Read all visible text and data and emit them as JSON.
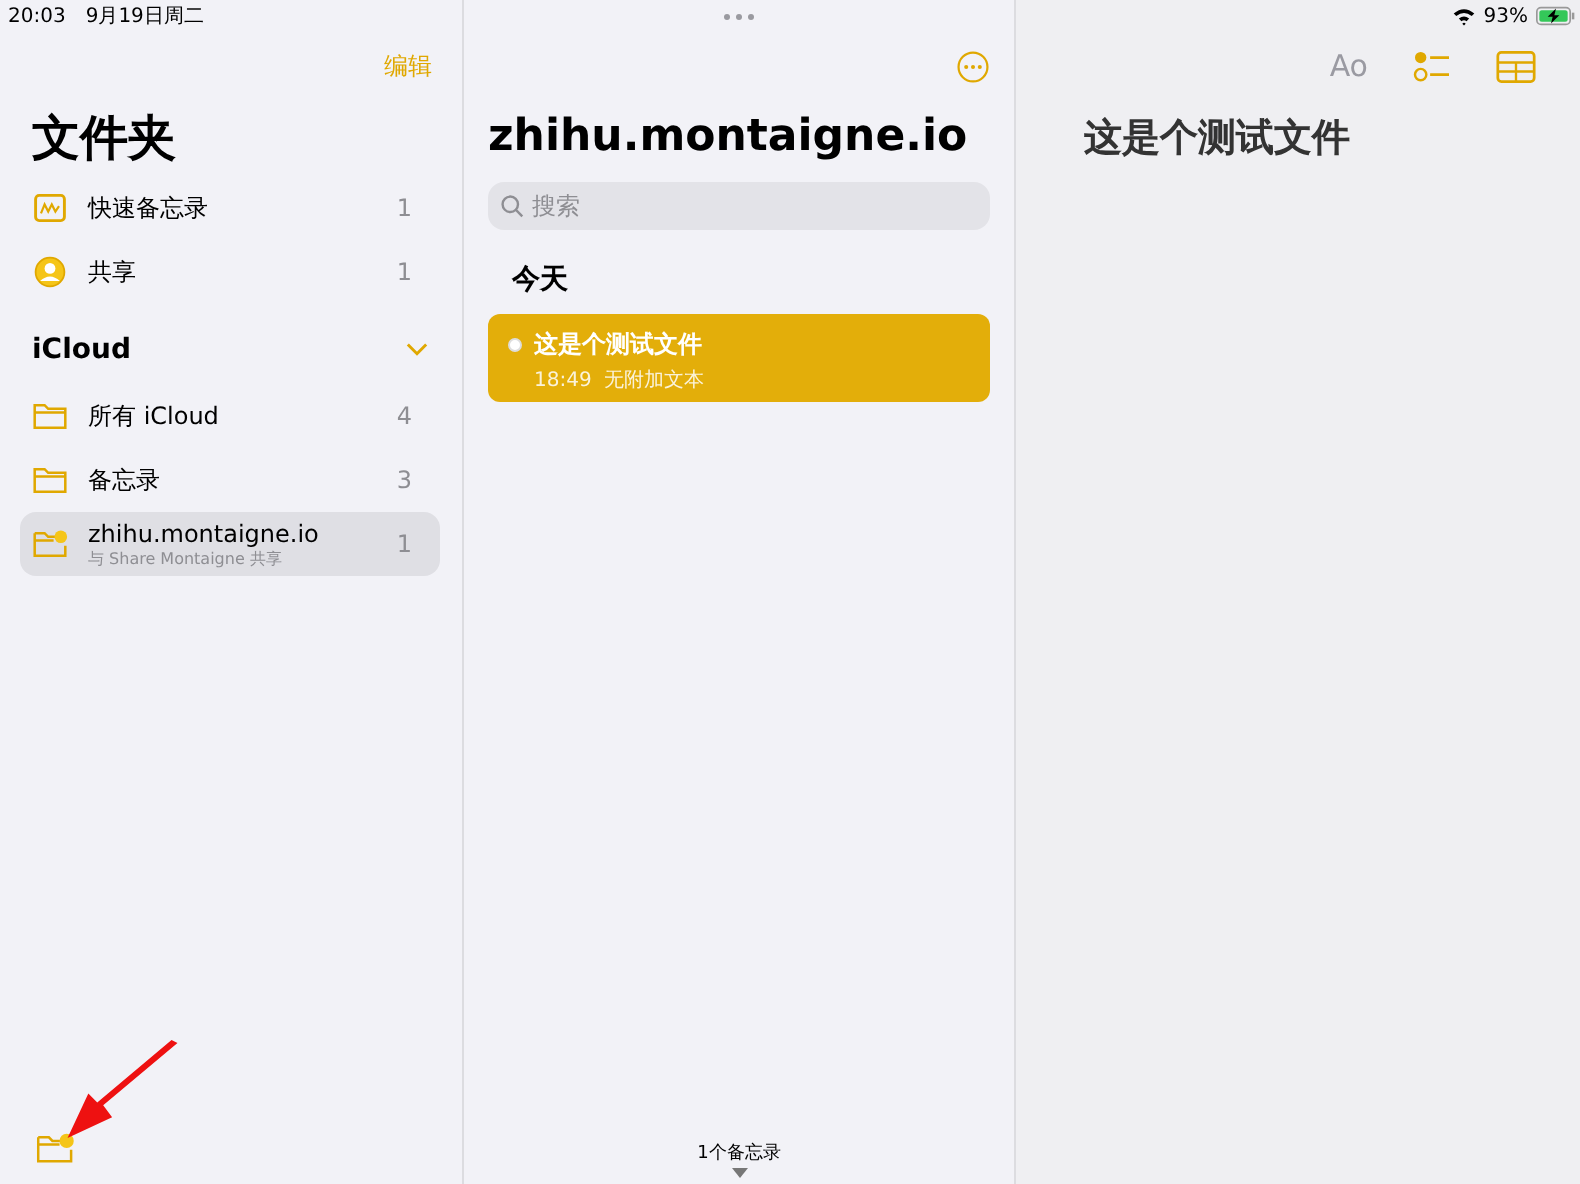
{
  "status_bar": {
    "time": "20:03",
    "date": "9月19日周二",
    "battery": "93%"
  },
  "sidebar": {
    "edit_button": "编辑",
    "title": "文件夹",
    "items": [
      {
        "kind": "quicknote",
        "label": "快速备忘录",
        "count": "1",
        "selected": false
      },
      {
        "kind": "shared",
        "label": "共享",
        "count": "1",
        "selected": false
      }
    ],
    "section": {
      "title": "iCloud",
      "expanded": true
    },
    "folders": [
      {
        "kind": "folder",
        "label": "所有 iCloud",
        "count": "4",
        "selected": false
      },
      {
        "kind": "folder",
        "label": "备忘录",
        "count": "3",
        "selected": false
      },
      {
        "kind": "sharedfolder",
        "label": "zhihu.montaigne.io",
        "subtitle": "与 Share Montaigne 共享",
        "count": "1",
        "selected": true
      }
    ]
  },
  "note_list": {
    "title": "zhihu.montaigne.io",
    "search": {
      "placeholder": "搜索"
    },
    "group": "今天",
    "notes": [
      {
        "title": "这是个测试文件",
        "time": "18:49",
        "preview": "无附加文本",
        "selected": true
      }
    ],
    "footer": "1个备忘录"
  },
  "editor": {
    "format_button": "Ao",
    "title": "这是个测试文件"
  }
}
